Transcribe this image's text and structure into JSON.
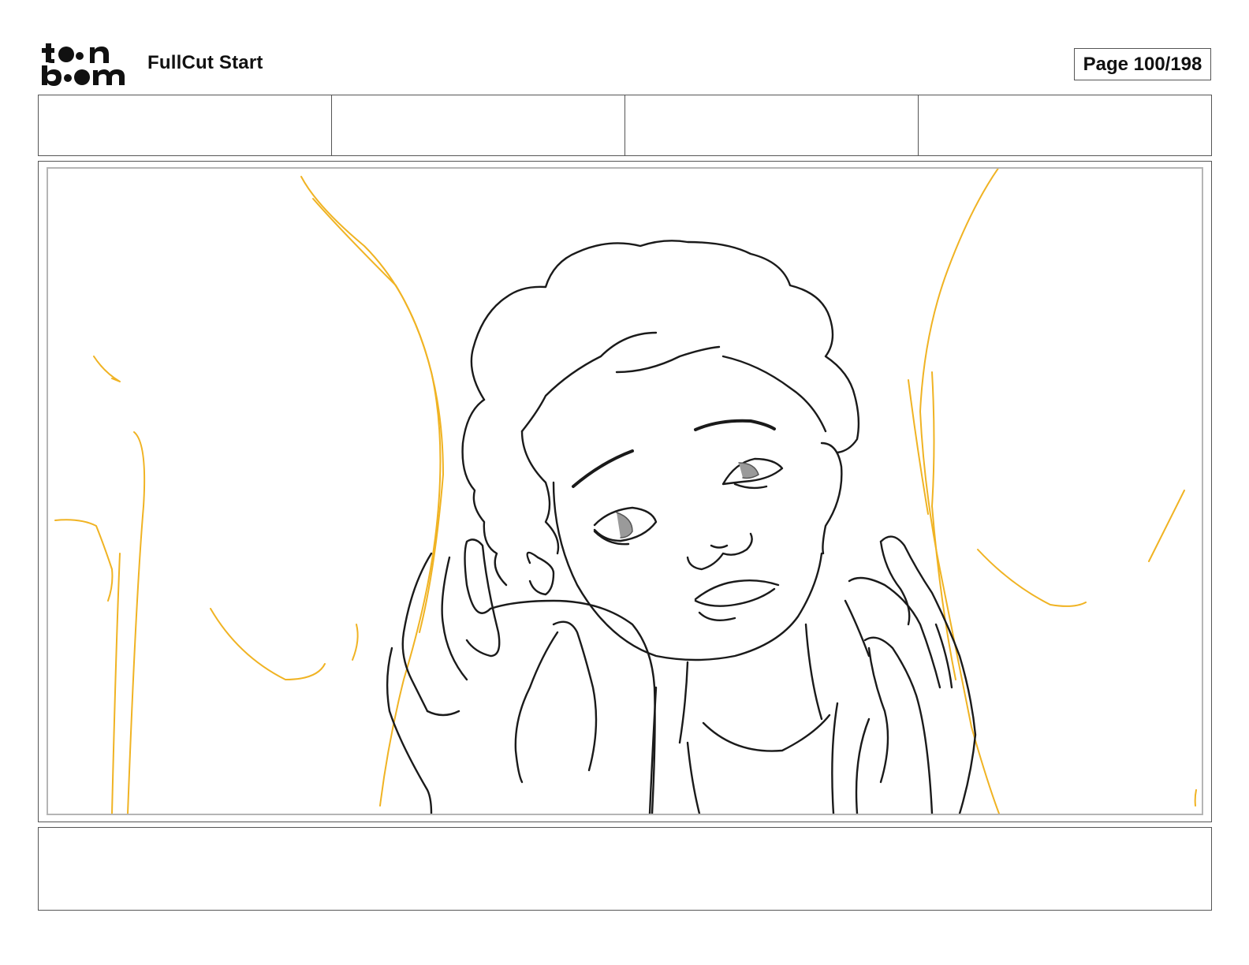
{
  "header": {
    "logo_text": "toon boom",
    "project_title": "FullCut Start",
    "page_label": "Page 100/198"
  },
  "info_row": {
    "cells": [
      "",
      "",
      "",
      ""
    ]
  },
  "panel": {
    "image_alt": "Storyboard sketch",
    "colors": {
      "ink": "#1a1a1a",
      "rough": "#f0b323",
      "frame": "#b5b5b5"
    }
  },
  "notes": {
    "text": ""
  }
}
